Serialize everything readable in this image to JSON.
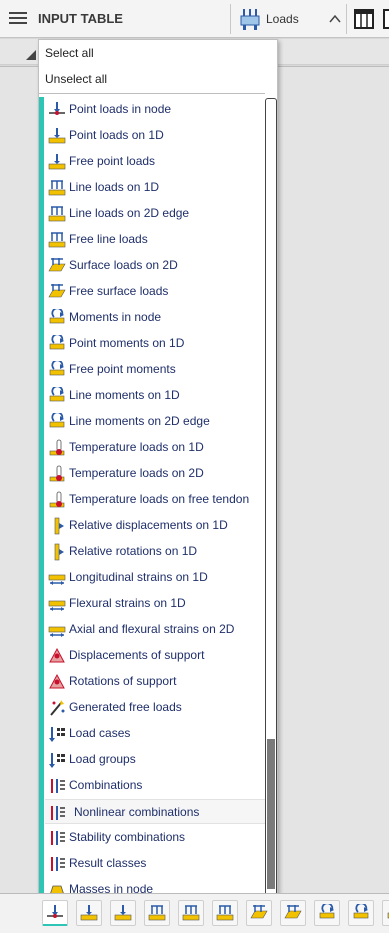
{
  "header": {
    "title": "INPUT TABLE",
    "loads_label": "Loads"
  },
  "dropdown": {
    "select_all": "Select all",
    "unselect_all": "Unselect all",
    "items": [
      {
        "label": "Point loads in node",
        "icon": "point-load-node-icon"
      },
      {
        "label": "Point loads on 1D",
        "icon": "point-load-1d-icon"
      },
      {
        "label": "Free point loads",
        "icon": "free-point-load-icon"
      },
      {
        "label": "Line loads on 1D",
        "icon": "line-load-1d-icon"
      },
      {
        "label": "Line loads on 2D edge",
        "icon": "line-load-2d-edge-icon"
      },
      {
        "label": "Free line loads",
        "icon": "free-line-load-icon"
      },
      {
        "label": "Surface loads on 2D",
        "icon": "surface-load-2d-icon"
      },
      {
        "label": "Free surface loads",
        "icon": "free-surface-load-icon"
      },
      {
        "label": "Moments in node",
        "icon": "moment-node-icon"
      },
      {
        "label": "Point moments on 1D",
        "icon": "point-moment-1d-icon"
      },
      {
        "label": "Free point moments",
        "icon": "free-point-moment-icon"
      },
      {
        "label": "Line moments on 1D",
        "icon": "line-moment-1d-icon"
      },
      {
        "label": "Line moments on 2D edge",
        "icon": "line-moment-2d-edge-icon"
      },
      {
        "label": "Temperature loads on 1D",
        "icon": "temperature-1d-icon"
      },
      {
        "label": "Temperature loads on 2D",
        "icon": "temperature-2d-icon"
      },
      {
        "label": "Temperature loads on free tendon",
        "icon": "temperature-tendon-icon"
      },
      {
        "label": "Relative displacements on 1D",
        "icon": "relative-displacement-icon"
      },
      {
        "label": "Relative rotations on 1D",
        "icon": "relative-rotation-icon"
      },
      {
        "label": "Longitudinal strains on 1D",
        "icon": "longitudinal-strain-icon"
      },
      {
        "label": "Flexural strains on 1D",
        "icon": "flexural-strain-icon"
      },
      {
        "label": "Axial and flexural strains on 2D",
        "icon": "axial-flexural-strain-icon"
      },
      {
        "label": "Displacements of support",
        "icon": "support-displacement-icon"
      },
      {
        "label": "Rotations of support",
        "icon": "support-rotation-icon"
      },
      {
        "label": "Generated free loads",
        "icon": "generated-loads-icon"
      },
      {
        "label": "Load cases",
        "icon": "load-cases-icon"
      },
      {
        "label": "Load groups",
        "icon": "load-groups-icon"
      },
      {
        "label": "Combinations",
        "icon": "combinations-icon"
      },
      {
        "label": "Nonlinear combinations",
        "icon": "nonlinear-combinations-icon"
      },
      {
        "label": "Stability combinations",
        "icon": "stability-combinations-icon"
      },
      {
        "label": "Result classes",
        "icon": "result-classes-icon"
      },
      {
        "label": "Masses in node",
        "icon": "masses-node-icon"
      }
    ],
    "selected_index": 27
  },
  "colors": {
    "accent": "#2ec4b6",
    "label": "#1f2f6a",
    "icon_yellow": "#f2c200",
    "icon_blue": "#2a5aa8",
    "icon_red": "#c8102e"
  },
  "bottom_bar": {
    "buttons": [
      "point-load-node-icon",
      "point-load-1d-icon",
      "free-point-load-icon",
      "line-load-1d-icon",
      "line-load-2d-edge-icon",
      "free-line-load-icon",
      "surface-load-2d-icon",
      "free-surface-load-icon",
      "moment-node-icon",
      "point-moment-1d-icon",
      "free-point-moment-icon"
    ],
    "active_index": 0
  }
}
